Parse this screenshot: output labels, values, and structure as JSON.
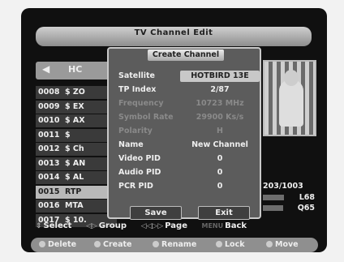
{
  "window": {
    "title": "TV Channel Edit"
  },
  "list_header": {
    "nav_arrow": "◀",
    "label": "HC"
  },
  "channels": [
    {
      "num": "0008",
      "name": "$ ZO"
    },
    {
      "num": "0009",
      "name": "$ EX"
    },
    {
      "num": "0010",
      "name": "$ AX"
    },
    {
      "num": "0011",
      "name": "$"
    },
    {
      "num": "0012",
      "name": "$ Ch"
    },
    {
      "num": "0013",
      "name": "$ AN"
    },
    {
      "num": "0014",
      "name": "$ AL"
    },
    {
      "num": "0015",
      "name": "RTP"
    },
    {
      "num": "0016",
      "name": "MTA"
    },
    {
      "num": "0017",
      "name": "$ 10."
    }
  ],
  "selected_channel_index": 7,
  "dialog": {
    "title": "Create Channel",
    "fields": [
      {
        "label": "Satellite",
        "value": "HOTBIRD 13E"
      },
      {
        "label": "TP Index",
        "value": "2/87"
      },
      {
        "label": "Frequency",
        "value": "10723 MHz"
      },
      {
        "label": "Symbol Rate",
        "value": "29900 Ks/s"
      },
      {
        "label": "Polarity",
        "value": "H"
      },
      {
        "label": "Name",
        "value": "New Channel"
      },
      {
        "label": "Video PID",
        "value": "0"
      },
      {
        "label": "Audio PID",
        "value": "0"
      },
      {
        "label": "PCR PID",
        "value": "0"
      }
    ],
    "save_label": "Save",
    "exit_label": "Exit"
  },
  "info": {
    "counter": "203/1003",
    "level_label": "L68",
    "quality_label": "Q65",
    "level_value": 68,
    "quality_value": 65
  },
  "hints": {
    "select": "Select",
    "group": "Group",
    "page": "Page",
    "menu": "MENU",
    "back": "Back",
    "select_icon": "⇕",
    "group_icon": "◁▷",
    "page_icon": "◁◁▷▷"
  },
  "color_keys": [
    {
      "label": "Delete"
    },
    {
      "label": "Create"
    },
    {
      "label": "Rename"
    },
    {
      "label": "Lock"
    },
    {
      "label": "Move"
    }
  ]
}
